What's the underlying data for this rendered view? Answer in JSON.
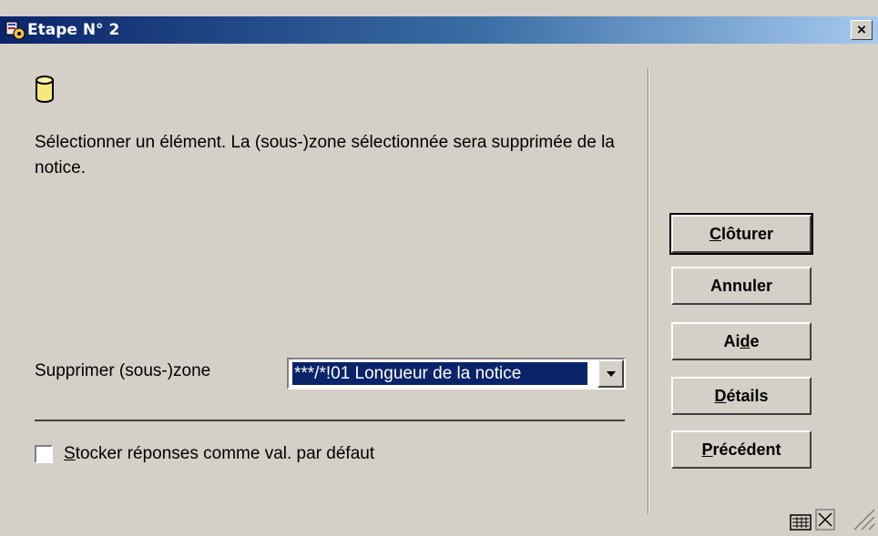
{
  "window": {
    "title": "Etape N° 2",
    "close_label": "×"
  },
  "main": {
    "message": "Sélectionner un élément. La (sous-)zone sélectionnée sera supprimée de la notice.",
    "field_label": "Supprimer (sous-)zone",
    "select_value": "***/*!01 Longueur de la notice",
    "checkbox": {
      "checked": false,
      "mnemonic": "S",
      "label_rest": "tocker réponses comme val. par défaut"
    }
  },
  "buttons": {
    "cloturer": {
      "before": "",
      "mnemonic": "C",
      "after": "lôturer"
    },
    "annuler": {
      "label": "Annuler"
    },
    "aide": {
      "before": "Ai",
      "mnemonic": "d",
      "after": "e"
    },
    "details": {
      "before": "",
      "mnemonic": "D",
      "after": "étails"
    },
    "precedent": {
      "before": "",
      "mnemonic": "P",
      "after": "récédent"
    }
  },
  "icons": {
    "title": "app-icon",
    "database": "database-icon",
    "dropdown": "chevron-down-icon",
    "keyboard": "keyboard-icon",
    "resize": "resize-grip-icon"
  },
  "colors": {
    "title_bar_start": "#0a246a",
    "title_bar_end": "#a6caf0",
    "selection": "#0a246a",
    "face": "#d4d0c8"
  }
}
